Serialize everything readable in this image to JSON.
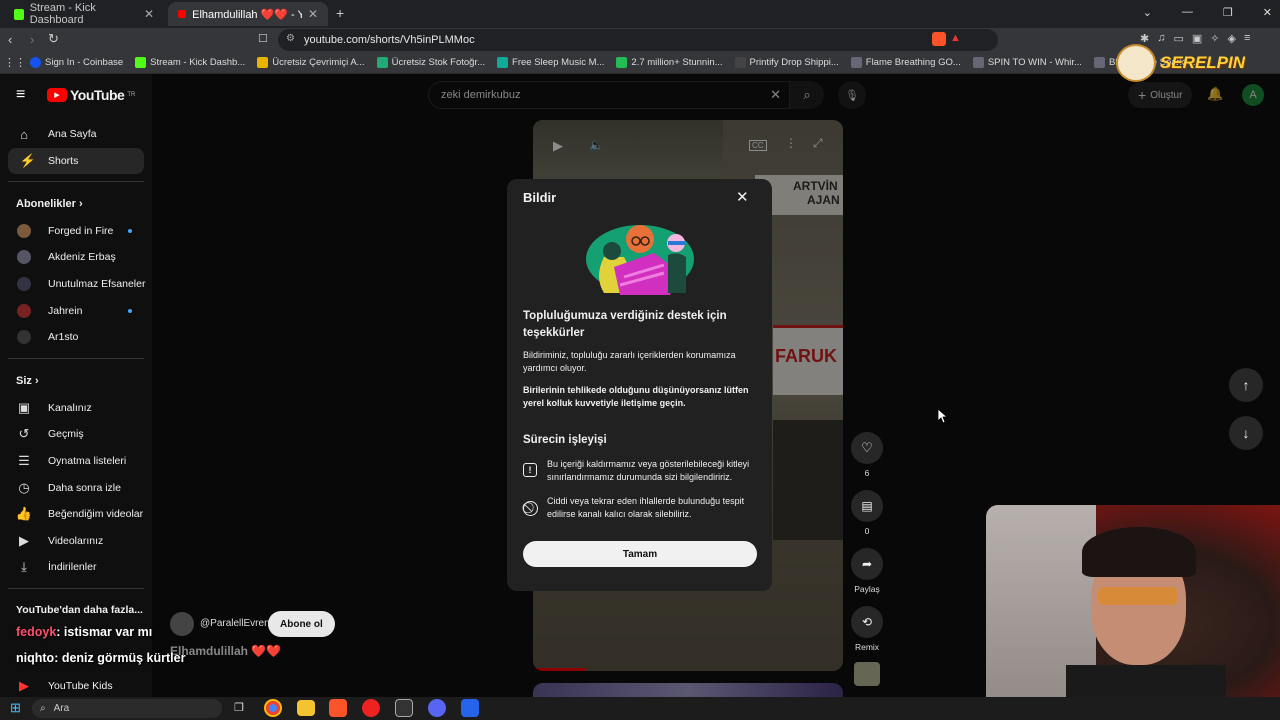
{
  "browser": {
    "tabs": [
      {
        "title": "Stream - Kick Dashboard",
        "close": "✕"
      },
      {
        "title": "Elhamdulillah ❤️❤️ - YouTube",
        "close": "✕"
      }
    ],
    "new_tab": "+",
    "url": "youtube.com/shorts/Vh5inPLMMoc",
    "bookmarks": [
      "Sign In - Coinbase",
      "Stream - Kick Dashb...",
      "Ücretsiz Çevrimiçi A...",
      "Ücretsiz Stok Fotoğr...",
      "Free Sleep Music M...",
      "2.7 million+ Stunnin...",
      "Printify Drop Shippi...",
      "Flame Breathing GO...",
      "SPIN TO WIN - Whir...",
      "Bloodmage Spark -..."
    ],
    "window_controls": [
      "⌄",
      "—",
      "❐",
      "✕"
    ]
  },
  "youtube": {
    "logo": "YouTube",
    "logo_sup": "TR",
    "search_value": "zeki demirkubuz",
    "create_label": "Oluştur",
    "avatar_letter": "A",
    "sidebar": {
      "main": [
        {
          "label": "Ana Sayfa",
          "icon": "home-icon"
        },
        {
          "label": "Shorts",
          "icon": "shorts-icon"
        }
      ],
      "subs_title": "Abonelikler",
      "subs": [
        {
          "label": "Forged in Fire",
          "new": true
        },
        {
          "label": "Akdeniz Erbaş",
          "new": false
        },
        {
          "label": "Unutulmaz Efsaneler",
          "new": false
        },
        {
          "label": "Jahrein",
          "new": true
        },
        {
          "label": "Ar1sto",
          "new": false
        }
      ],
      "you_title": "Siz",
      "you": [
        {
          "label": "Kanalınız"
        },
        {
          "label": "Geçmiş"
        },
        {
          "label": "Oynatma listeleri"
        },
        {
          "label": "Daha sonra izle"
        },
        {
          "label": "Beğendiğim videolar"
        },
        {
          "label": "Videolarınız"
        },
        {
          "label": "İndirilenler"
        }
      ],
      "more_title": "YouTube'dan daha fazla...",
      "more": [
        {
          "label": "YouTube Kids"
        }
      ]
    },
    "short": {
      "channel": "@ParalellEvren",
      "subscribe": "Abone ol",
      "title": "Elhamdulillah ❤️❤️",
      "likes": "6",
      "comments": "0",
      "share": "Paylaş",
      "remix": "Remix",
      "poster_text_1": "ARTVİN",
      "poster_text_2": "AJAN",
      "poster_text_3": "FARUK"
    }
  },
  "dialog": {
    "title": "Bildir",
    "heading": "Topluluğumuza verdiğiniz destek için teşekkürler",
    "body1": "Bildiriminiz, topluluğu zararlı içeriklerden korumamıza yardımcı oluyor.",
    "body2": "Birilerinin tehlikede olduğunu düşünüyorsanız lütfen yerel kolluk kuvvetiyle iletişime geçin.",
    "process_title": "Sürecin işleyişi",
    "step1": "Bu içeriği kaldırmamız veya gösterilebileceği kitleyi sınırlandırmamız durumunda sizi bilgilendiririz.",
    "step2": "Ciddi veya tekrar eden ihlallerde bulunduğu tespit edilirse kanalı kalıcı olarak silebiliriz.",
    "ok": "Tamam"
  },
  "overlay": {
    "chat": [
      {
        "user": "fedoyk",
        "text": ": istismar var mı"
      },
      {
        "user": "niqhto",
        "text": ": deniz görmüş kürtler"
      }
    ],
    "brand": "SERELPIN"
  },
  "taskbar": {
    "search": "Ara"
  }
}
